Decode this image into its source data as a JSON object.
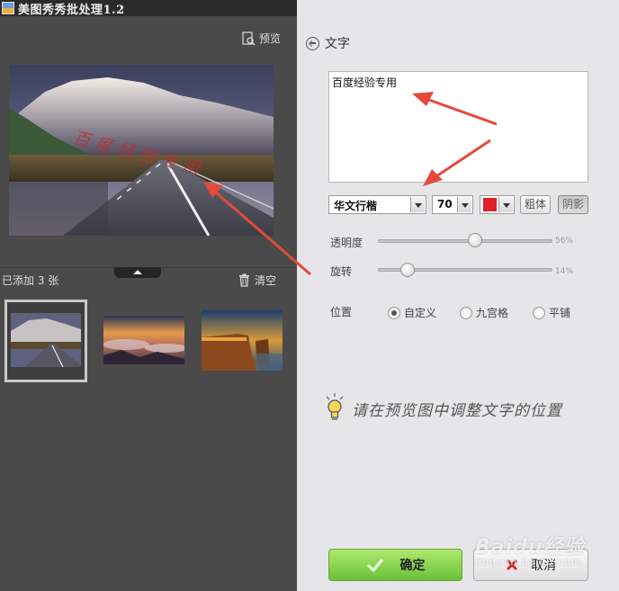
{
  "window": {
    "title": "美图秀秀批处理1.2"
  },
  "left_panel": {
    "preview_label": "预览",
    "preview_overlay_text": "百度经验专用",
    "added_count_text": "已添加 3 张",
    "clear_label": "清空",
    "thumbnails": [
      {
        "name": "road-and-mountain",
        "selected": true
      },
      {
        "name": "sunset-clouds",
        "selected": false
      },
      {
        "name": "coastal-cliff",
        "selected": false
      }
    ]
  },
  "right_panel": {
    "section_title": "文字",
    "text_input_value": "百度经验专用",
    "font_family_value": "华文行楷",
    "font_size_value": "70",
    "font_color": "#e0202a",
    "bold_label": "粗体",
    "shadow_label": "阴影",
    "opacity": {
      "label": "透明度",
      "value_text": "56%",
      "value": 0.56
    },
    "rotation": {
      "label": "旋转",
      "value_text": "14%",
      "value": 0.14
    },
    "position": {
      "label": "位置",
      "options": [
        "自定义",
        "九宫格",
        "平铺"
      ],
      "selected": "自定义"
    },
    "hint_text": "请在预览图中调整文字的位置",
    "ok_label": "确定",
    "cancel_label": "取消"
  },
  "watermark": {
    "brand": "Baidu经验",
    "url": "jingyan.baidu.com"
  },
  "colors": {
    "annotation_arrow": "#e34a3c",
    "ok_button": "#7dcc45",
    "panel_bg": "#e6e5e8",
    "left_bg": "#4a4a4a"
  }
}
